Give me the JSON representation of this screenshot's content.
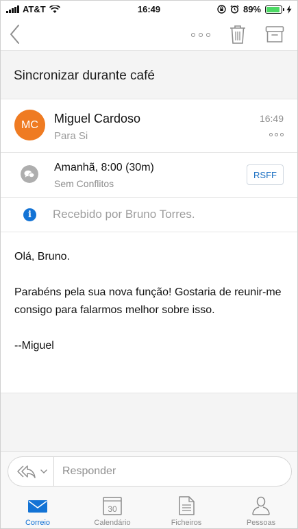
{
  "status_bar": {
    "carrier": "AT&T",
    "time": "16:49",
    "battery_percent": "89%",
    "battery_level": 0.89,
    "icons": [
      "signal-icon",
      "wifi-icon",
      "orientation-lock-icon",
      "alarm-icon",
      "battery-icon",
      "charging-icon"
    ]
  },
  "toolbar": {
    "icons": [
      "back-chevron-icon",
      "more-icon",
      "trash-icon",
      "archive-icon"
    ]
  },
  "subject": "Sincronizar durante café",
  "sender": {
    "initials": "MC",
    "avatar_color": "#ef7b22",
    "name": "Miguel Cardoso",
    "to": "Para Si",
    "time": "16:49"
  },
  "meeting": {
    "title": "Amanhã, 8:00 (30m)",
    "conflicts": "Sem Conflitos",
    "rsvp_label": "RSFF"
  },
  "info": {
    "text": "Recebido por Bruno Torres."
  },
  "message": {
    "greeting": "Olá, Bruno.",
    "paragraph": "Parabéns pela sua nova função! Gostaria de reunir-me consigo para falarmos melhor sobre isso.",
    "signature": "--Miguel"
  },
  "reply": {
    "placeholder": "Responder"
  },
  "tabs": [
    {
      "label": "Correio",
      "icon": "mail-icon",
      "active": true
    },
    {
      "label": "Calendário",
      "icon": "calendar-icon",
      "day": "30",
      "active": false
    },
    {
      "label": "Ficheiros",
      "icon": "files-icon",
      "active": false
    },
    {
      "label": "Pessoas",
      "icon": "people-icon",
      "active": false
    }
  ],
  "colors": {
    "accent": "#1373d5",
    "avatar": "#ef7b22",
    "battery": "#4cd964"
  }
}
